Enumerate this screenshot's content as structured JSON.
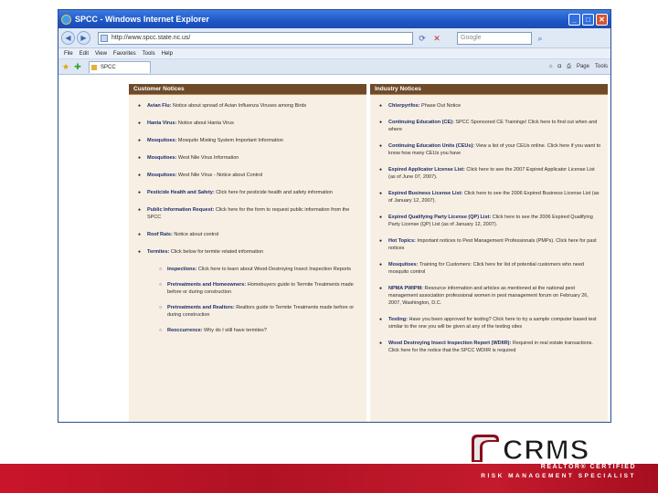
{
  "browser": {
    "title": "SPCC - Windows Internet Explorer",
    "address": "http://www.spcc.state.nc.us/",
    "search_placeholder": "Google",
    "menu": [
      "File",
      "Edit",
      "View",
      "Favorites",
      "Tools",
      "Help"
    ],
    "tab_label": "SPCC",
    "commands": [
      "Page",
      "Tools"
    ]
  },
  "left_column": {
    "header": "Customer Notices",
    "items": [
      {
        "title": "Avian Flu:",
        "text": " Notice about spread of Avian Influenza Viruses among Birds"
      },
      {
        "title": "Hanta Virus:",
        "text": " Notice about Hanta Virus"
      },
      {
        "title": "Mosquitoes:",
        "text": " Mosquito Misting System Important Information"
      },
      {
        "title": "Mosquitoes:",
        "text": " West Nile Virus Information"
      },
      {
        "title": "Mosquitoes:",
        "text": " West Nile Virus - Notice about Control"
      },
      {
        "title": "Pesticide Health and Safety:",
        "text": " Click here for pesticide health and safety information"
      },
      {
        "title": "Public Information Request:",
        "text": " Click here for the form to request public information from the SPCC"
      },
      {
        "title": "Roof Rats:",
        "text": " Notice about control"
      },
      {
        "title": "Termites:",
        "text": " Click below for termite related information"
      }
    ],
    "sub_items": [
      {
        "title": "Inspections:",
        "text": " Click here to learn about Wood-Destroying Insect Inspection Reports"
      },
      {
        "title": "Pretreatments and Homeowners:",
        "text": " Homebuyers guide to Termite Treatments made before or during construction"
      },
      {
        "title": "Pretreatments and Realtors:",
        "text": " Realtors guide to Termite Treatments made before or during construction"
      },
      {
        "title": "Reoccurrence:",
        "text": " Why do I still have termites?"
      }
    ]
  },
  "right_column": {
    "header": "Industry Notices",
    "items": [
      {
        "title": "Chlorpyrifos:",
        "text": " Phase Out Notice"
      },
      {
        "title": "Continuing Education (CE):",
        "text": " SPCC Sponsored CE Trainings! Click here to find out when and where"
      },
      {
        "title": "Continuing Education Units (CEUs):",
        "text": " View a list of your CEUs online. Click here if you want to know how many CEUs you have"
      },
      {
        "title": "Expired Applicator License List:",
        "text": " Click here to see the 2007 Expired Applicator License List (as of June 07, 2007)."
      },
      {
        "title": "Expired Business License List:",
        "text": " Click here to see the 2006 Expired Business License List (as of January 12, 2007)."
      },
      {
        "title": "Expired Qualifying Party License (QP) List:",
        "text": " Click here to see the 2006 Expired Qualifying Party License (QP) List (as of January 12, 2007)."
      },
      {
        "title": "Hot Topics:",
        "text": " Important notices to Pest Management Professionals (PMPs). Click here for past notices"
      },
      {
        "title": "Mosquitoes:",
        "text": " Training for Customers: Click here for list of potential customers who need mosquito control"
      },
      {
        "title": "NPMA PWIPM:",
        "text": " Resource information and articles as mentioned at the national pest management association professional women in pest management forum on February 26, 2007, Washington, D.C."
      },
      {
        "title": "Testing:",
        "text": " Have you been approved for testing? Click here to try a sample computer based test similar to the one you will be given at any of the testing sites"
      },
      {
        "title": "Wood Destroying Insect Inspection Report (WDIIR):",
        "text": " Required in real estate transactions. Click here for the notice that the SPCC WDIIR is required"
      }
    ]
  },
  "logo": {
    "wordmark": "CRMS",
    "line1": "REALTOR® CERTIFIED",
    "line2": "RISK MANAGEMENT SPECIALIST"
  }
}
